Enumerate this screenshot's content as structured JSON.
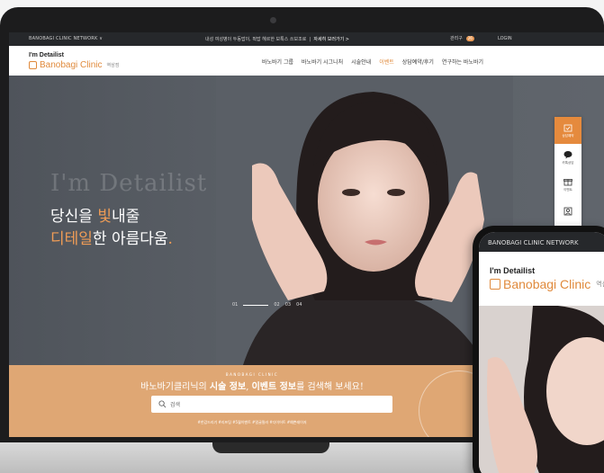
{
  "laptop": {
    "network_bar": {
      "left": "BANOBAGI CLINIC NETWORK  ∨",
      "center_text": "내성 여성병이 두동밥이, 퍽밥 헤르한 보톡스 쓰보조로",
      "center_link": "자세히 보러가기 >",
      "right_label": "관리구 ",
      "right_badge": "26",
      "login": "LOGIN"
    },
    "header": {
      "logo_top": "I'm Detailist",
      "logo_main": "Banobagi Clinic",
      "logo_branch": "역삼점",
      "menu": [
        "바노바기 그룹",
        "바노바기 시그니처",
        "시술안내",
        "이벤트",
        "상담예약/후기",
        "연구하는 바노바기"
      ],
      "active_menu": "이벤트"
    },
    "hero": {
      "en_title": "I'm Detailist",
      "line1_pre": "당신을 ",
      "line1_accent": "빛",
      "line1_post": "내줄",
      "line2_accent": "디테일",
      "line2_post": "한 아름다움",
      "line2_dot": ".",
      "pager": [
        "01",
        "02",
        "03",
        "04"
      ]
    },
    "quick_menu": [
      {
        "label": "상담예약",
        "icon": "calendar-check-icon"
      },
      {
        "label": "카톡상담",
        "icon": "chat-bubble-icon"
      },
      {
        "label": "이벤트",
        "icon": "gift-icon"
      },
      {
        "label": "",
        "icon": "user-icon"
      }
    ],
    "search": {
      "overline": "BANOBAGI CLINIC",
      "title_pre": "바노바기클리닉의 ",
      "title_b1": "시술 정보",
      "title_mid": ", ",
      "title_b2": "이벤트 정보",
      "title_post": "를 검색해 보세요!",
      "placeholder": "검색",
      "tags": "#한감드리기  #리프팅  #5월이벤트  #얼굴필러  #다이어트  #예쁜레이저"
    }
  },
  "phone": {
    "network_bar": "BANOBAGI CLINIC NETWORK",
    "logo_top": "I'm Detailist",
    "logo_main": "Banobagi Clinic",
    "logo_branch": "역삼"
  },
  "colors": {
    "accent": "#e08a3c",
    "search_band": "#dfa774",
    "hero_bg": "#55595f",
    "net_bar": "#26282b"
  }
}
